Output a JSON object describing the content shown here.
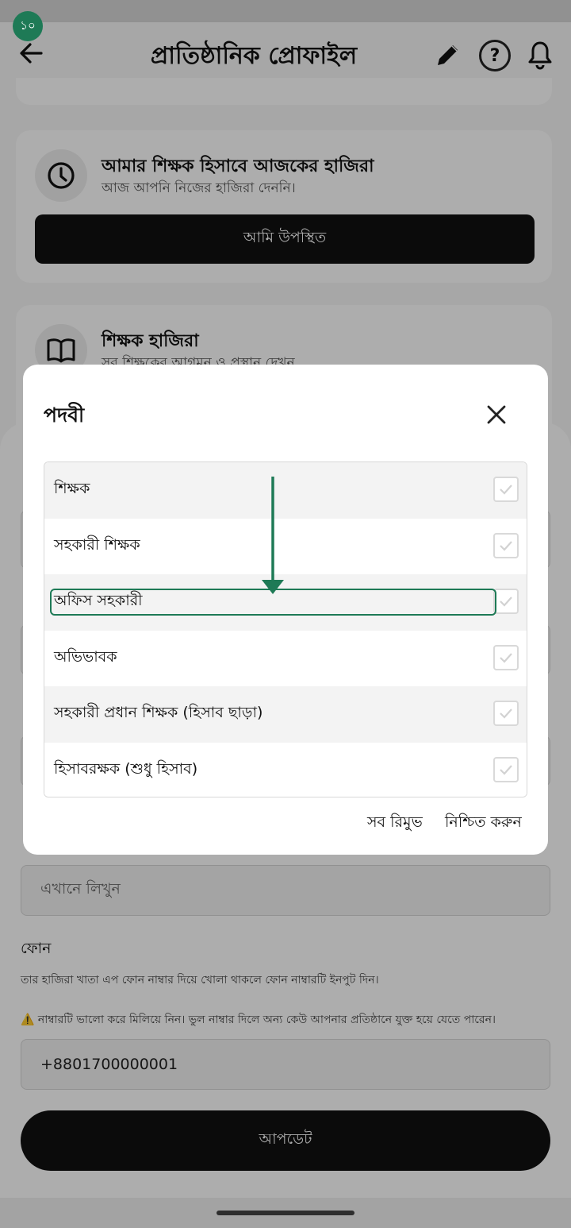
{
  "step_badge": "১০",
  "header": {
    "title": "প্রাতিষ্ঠানিক প্রোফাইল",
    "help_symbol": "?",
    "icons": [
      "back-arrow-icon",
      "pencil-icon",
      "help-icon",
      "bell-icon"
    ]
  },
  "attendance_card": {
    "title": "আমার শিক্ষক হিসাবে আজকের হাজিরা",
    "subtitle": "আজ আপনি নিজের হাজিরা দেননি।",
    "button_label": "আমি উপস্থিত",
    "icon": "clock-icon"
  },
  "teacher_card": {
    "title": "শিক্ষক হাজিরা",
    "subtitle": "সব শিক্ষকের আগমন ও প্রস্থান দেখুন",
    "icon": "book-icon"
  },
  "dialog": {
    "title": "পদবী",
    "options": [
      {
        "label": "শিক্ষক",
        "checked": false
      },
      {
        "label": "সহকারী শিক্ষক",
        "checked": false
      },
      {
        "label": "অফিস সহকারী",
        "checked": false
      },
      {
        "label": "অভিভাবক",
        "checked": false
      },
      {
        "label": "সহকারী প্রধান শিক্ষক (হিসাব ছাড়া)",
        "checked": false
      },
      {
        "label": "হিসাবরক্ষক (শুধু হিসাব)",
        "checked": false
      }
    ],
    "remove_all_label": "সব রিমুভ",
    "confirm_label": "নিশ্চিত করুন"
  },
  "form": {
    "text_field_placeholder": "এখানে লিখুন",
    "phone_label": "ফোন",
    "phone_note": "তার হাজিরা খাতা এপ ফোন নাম্বার দিয়ে খোলা থাকলে ফোন নাম্বারটি ইনপুট দিন।",
    "warning_note": "⚠️ নাম্বারটি ভালো করে মিলিয়ে নিন। ভুল নাম্বার দিলে অন্য কেউ আপনার প্রতিষ্ঠানে যুক্ত হয়ে যেতে পারেন।",
    "phone_value": "+8801700000001",
    "update_label": "আপডেট"
  },
  "colors": {
    "accent_green": "#1e7a56",
    "primary_button": "#111111",
    "scrim": "rgba(0,0,0,0.32)"
  }
}
